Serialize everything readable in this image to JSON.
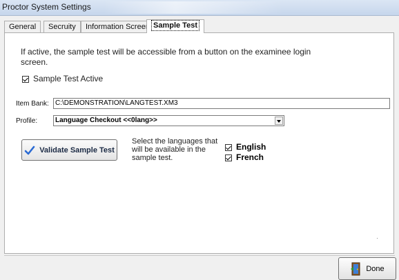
{
  "window": {
    "title": "Proctor System Settings"
  },
  "tabs": [
    {
      "label": "General"
    },
    {
      "label": "Secruity"
    },
    {
      "label": "Information Screen"
    },
    {
      "label": "Sample Test",
      "selected": true
    }
  ],
  "panel": {
    "info_text": "If active, the sample test will be accessible from a button on the examinee login screen.",
    "sample_active": {
      "label": "Sample Test Active",
      "checked": true
    },
    "item_bank": {
      "label": "Item Bank:",
      "value": "C:\\DEMONSTRATION\\LANGTEST.XM3"
    },
    "profile": {
      "label": "Profile:",
      "value": "Language Checkout <<0lang>>"
    },
    "validate_button": "Validate Sample Test",
    "languages_description": "Select the languages that will be available in the sample test.",
    "languages": [
      {
        "label": "English",
        "checked": true
      },
      {
        "label": "French",
        "checked": true
      }
    ]
  },
  "footer": {
    "done_label": "Done"
  },
  "colors": {
    "titlebar": "#c6d6ec",
    "panel": "#ffffff",
    "window": "#f0f0f0",
    "checkmark_blue": "#2a6ad3"
  },
  "icons": {
    "validate": "checkmark-icon",
    "done": "exit-door-icon"
  }
}
